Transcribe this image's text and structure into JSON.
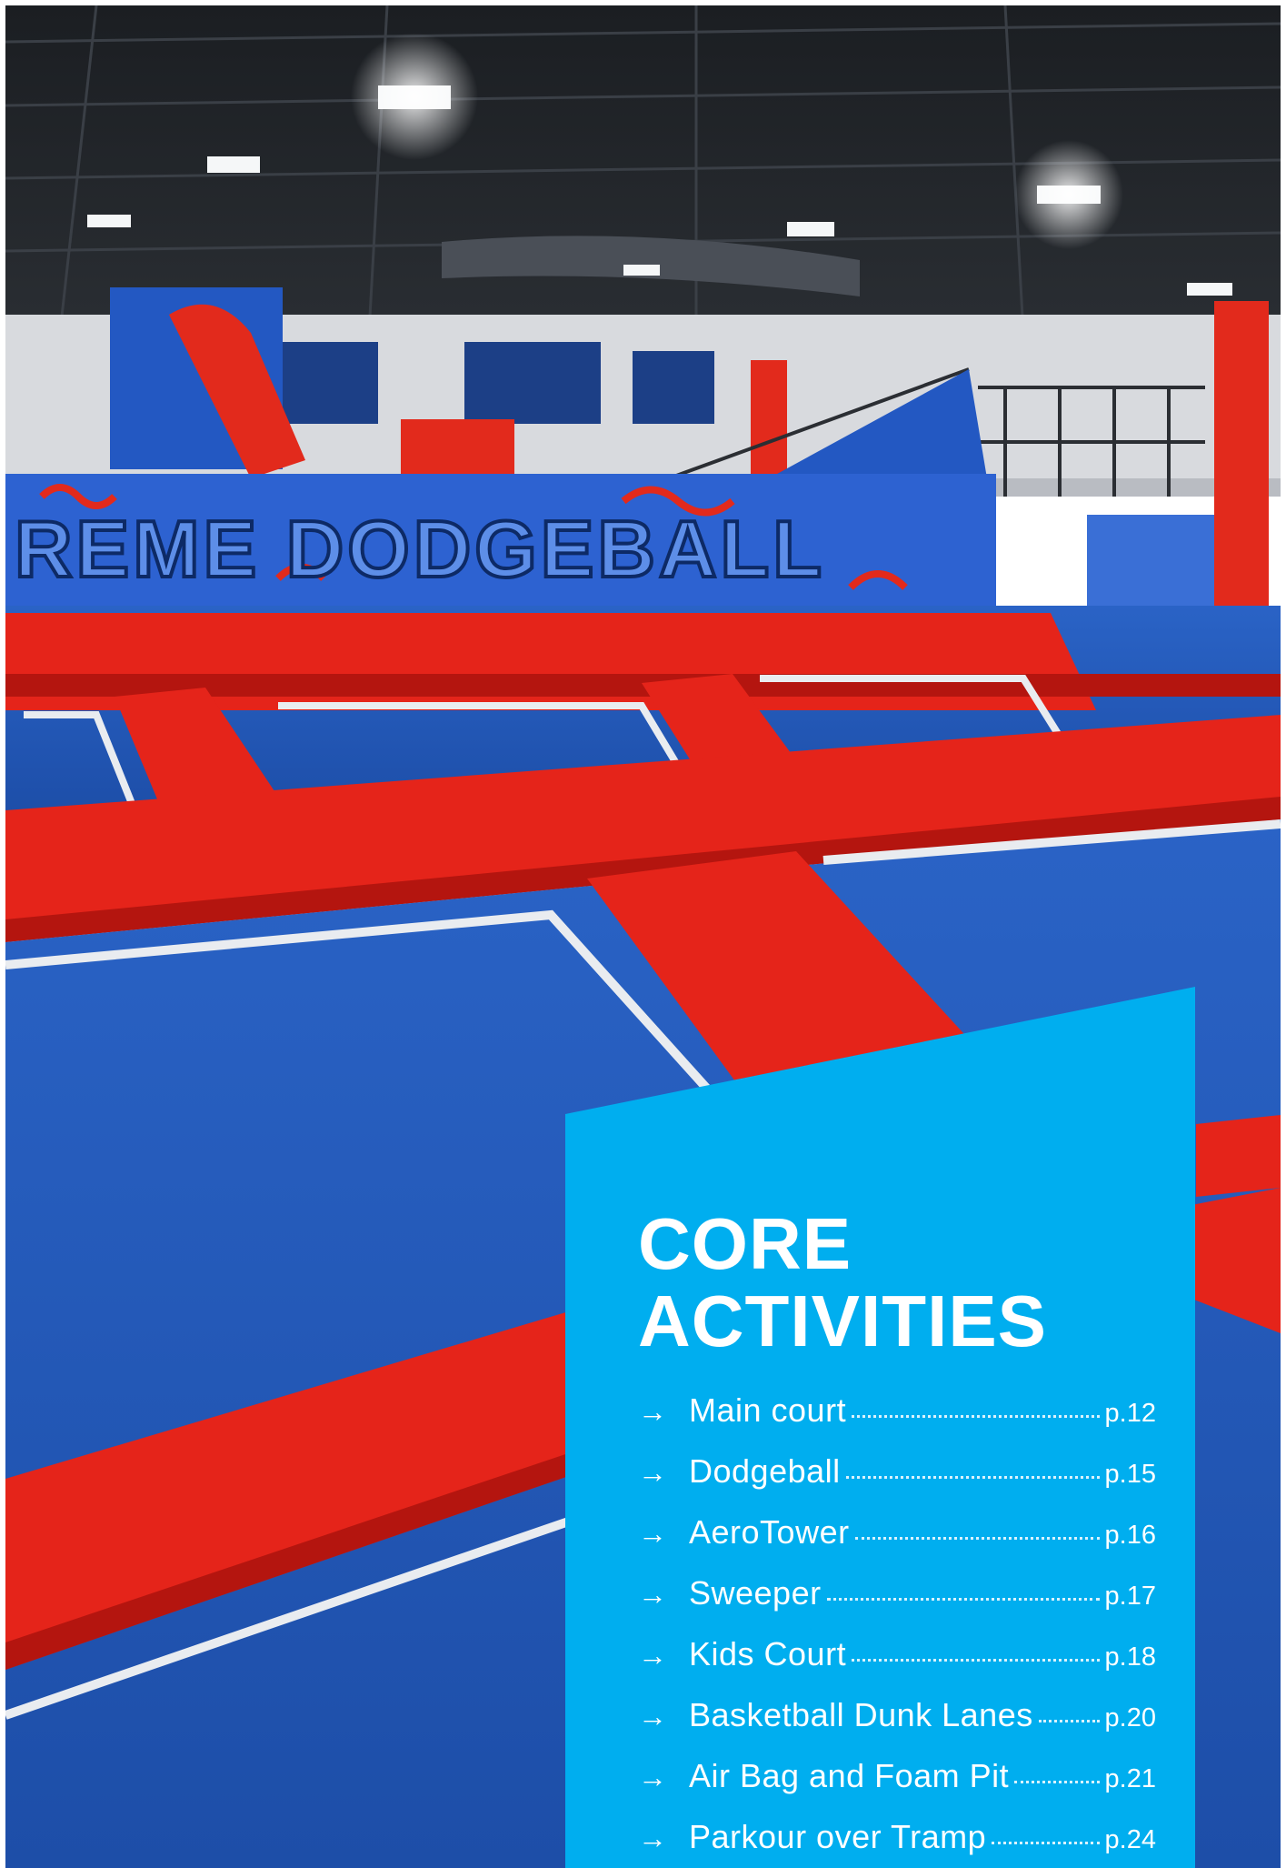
{
  "colors": {
    "panel_blue": "#00aeef",
    "trampoline_blue": "#1f55b8",
    "pad_red": "#e61b1b",
    "ceiling_dark": "#15181c"
  },
  "photo": {
    "banner_text": "REME DODGEBALL"
  },
  "section": {
    "title_line1": "CORE",
    "title_line2": "ACTIVITIES",
    "arrow_icon": "→",
    "items": [
      {
        "label": "Main court",
        "page": "p.12"
      },
      {
        "label": "Dodgeball",
        "page": "p.15"
      },
      {
        "label": "AeroTower",
        "page": "p.16"
      },
      {
        "label": "Sweeper",
        "page": "p.17"
      },
      {
        "label": "Kids Court",
        "page": "p.18"
      },
      {
        "label": "Basketball Dunk Lanes",
        "page": "p.20"
      },
      {
        "label": "Air Bag and Foam Pit",
        "page": "p.21"
      },
      {
        "label": "Parkour over Tramp",
        "page": "p.24"
      }
    ]
  }
}
